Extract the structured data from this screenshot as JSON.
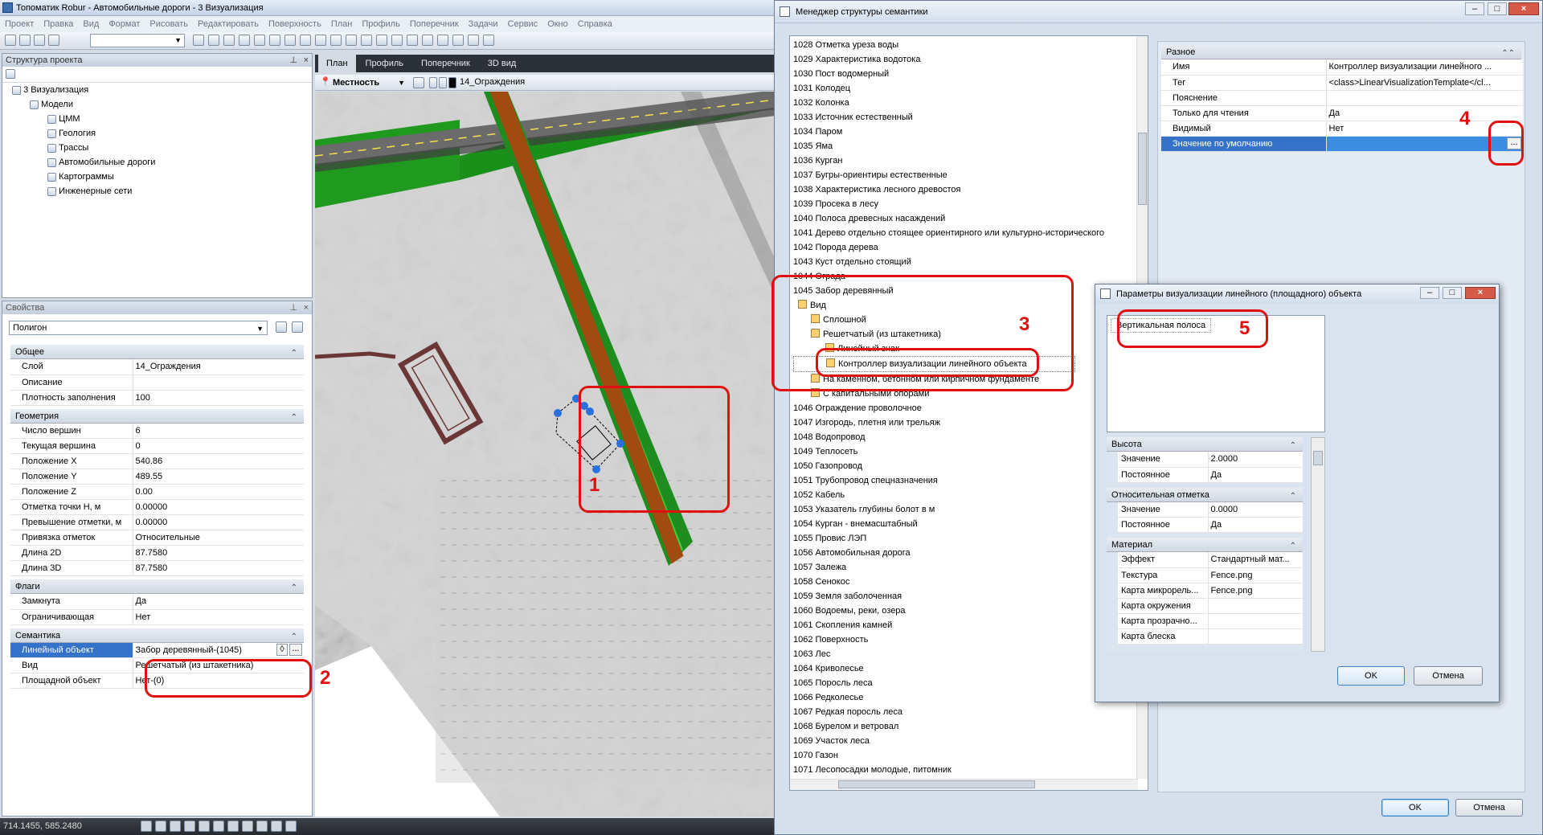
{
  "app_title": "Топоматик Robur - Автомобильные дороги - 3 Визуализация",
  "menu": [
    "Проект",
    "Правка",
    "Вид",
    "Формат",
    "Рисовать",
    "Редактировать",
    "Поверхность",
    "План",
    "Профиль",
    "Поперечник",
    "Задачи",
    "Сервис",
    "Окно",
    "Справка"
  ],
  "project_panel": {
    "title": "Структура проекта",
    "root": "3 Визуализация",
    "models": "Модели",
    "items": [
      "ЦММ",
      "Геология",
      "Трассы",
      "Автомобильные дороги",
      "Картограммы",
      "Инженерные сети"
    ]
  },
  "props_panel": {
    "title": "Свойства",
    "selected_type": "Полигон",
    "sections": [
      {
        "name": "Общее",
        "rows": [
          [
            "Слой",
            "14_Ограждения"
          ],
          [
            "Описание",
            ""
          ],
          [
            "Плотность заполнения",
            "100"
          ]
        ]
      },
      {
        "name": "Геометрия",
        "rows": [
          [
            "Число вершин",
            "6"
          ],
          [
            "Текущая вершина",
            "0"
          ],
          [
            "Положение X",
            "540.86"
          ],
          [
            "Положение Y",
            "489.55"
          ],
          [
            "Положение Z",
            "0.00"
          ],
          [
            "Отметка точки Н, м",
            "0.00000"
          ],
          [
            "Превышение отметки, м",
            "0.00000"
          ],
          [
            "Привязка отметок",
            "Относительные"
          ],
          [
            "Длина 2D",
            "87.7580"
          ],
          [
            "Длина 3D",
            "87.7580"
          ]
        ]
      },
      {
        "name": "Флаги",
        "rows": [
          [
            "Замкнута",
            "Да"
          ],
          [
            "Ограничивающая",
            "Нет"
          ]
        ]
      },
      {
        "name": "Семантика",
        "rows": [
          [
            "Линейный объект",
            "Забор деревянный-(1045)"
          ],
          [
            "Вид",
            "Решетчатый (из штакетника)"
          ],
          [
            "Площадной объект",
            "Нет-(0)"
          ]
        ]
      }
    ]
  },
  "view_tabs": [
    "План",
    "Профиль",
    "Поперечник",
    "3D вид"
  ],
  "view_toolbar": {
    "terrain": "Местность",
    "layer": "14_Ограждения"
  },
  "status_coords": "714.1455, 585.2480",
  "semantics_dialog": {
    "title": "Менеджер структуры семантики",
    "tree_before": [
      "1028 Отметка уреза воды",
      "1029 Характеристика водотока",
      "1030 Пост водомерный",
      "1031 Колодец",
      "1032 Колонка",
      "1033 Источник естественный",
      "1034 Паром",
      "1035 Яма",
      "1036 Курган",
      "1037 Бугры-ориентиры естественные",
      "1038 Характеристика лесного древостоя",
      "1039 Просека в лесу",
      "1040 Полоса древесных насаждений",
      "1041 Дерево отдельно стоящее ориентирного или культурно-исторического",
      "1042 Порода дерева",
      "1043 Куст отдельно стоящий",
      "1044 Ограда"
    ],
    "expanded": {
      "item": "1045 Забор деревянный",
      "vid": "Вид",
      "children": [
        "Сплошной",
        "Решетчатый (из штакетника)",
        "Линейный знак",
        "Контроллер визуализации линейного объекта",
        "На каменном, бетонном или кирпичном фундаменте",
        "С капитальными опорами"
      ]
    },
    "tree_after": [
      "1046 Ограждение проволочное",
      "1047 Изгородь, плетня или трельяж",
      "1048 Водопровод",
      "1049 Теплосеть",
      "1050 Газопровод",
      "1051 Трубопровод спецназначения",
      "1052 Кабель",
      "1053 Указатель глубины болот в м",
      "1054 Курган - внемасштабный",
      "1055 Провис ЛЭП",
      "1056 Автомобильная дорога",
      "1057 Залежа",
      "1058 Сенокос",
      "1059 Земля заболоченная",
      "1060 Водоемы, реки, озера",
      "1061 Скопления камней",
      "1062 Поверхность",
      "1063 Лес",
      "1064 Криволесье",
      "1065 Поросль леса",
      "1066 Редколесье",
      "1067 Редкая поросль леса",
      "1068 Бурелом и ветровал",
      "1069 Участок леса",
      "1070 Газон",
      "1071 Лесопосадки молодые, питомник"
    ],
    "props_section": "Разное",
    "props": [
      [
        "Имя",
        "Контроллер визуализации линейного ..."
      ],
      [
        "Тег",
        "<class>LinearVisualizationTemplate</cl..."
      ],
      [
        "Пояснение",
        ""
      ],
      [
        "Только для чтения",
        "Да"
      ],
      [
        "Видимый",
        "Нет"
      ],
      [
        "Значение по умолчанию",
        ""
      ]
    ],
    "ok": "OK",
    "cancel": "Отмена"
  },
  "vis_dialog": {
    "title": "Параметры визуализации линейного (площадного) объекта",
    "list_item": "Вертикальная полоса",
    "sections": [
      {
        "name": "Высота",
        "rows": [
          [
            "Значение",
            "2.0000"
          ],
          [
            "Постоянное",
            "Да"
          ]
        ]
      },
      {
        "name": "Относительная отметка",
        "rows": [
          [
            "Значение",
            "0.0000"
          ],
          [
            "Постоянное",
            "Да"
          ]
        ]
      },
      {
        "name": "Материал",
        "rows": [
          [
            "Эффект",
            "Стандартный мат..."
          ],
          [
            "Текстура",
            "Fence.png"
          ],
          [
            "Карта микрорель...",
            "Fence.png"
          ],
          [
            "Карта окружения",
            ""
          ],
          [
            "Карта прозрачно...",
            ""
          ],
          [
            "Карта блеска",
            ""
          ]
        ]
      }
    ],
    "ok": "OK",
    "cancel": "Отмена"
  },
  "annotations": [
    "1",
    "2",
    "3",
    "4",
    "5"
  ]
}
